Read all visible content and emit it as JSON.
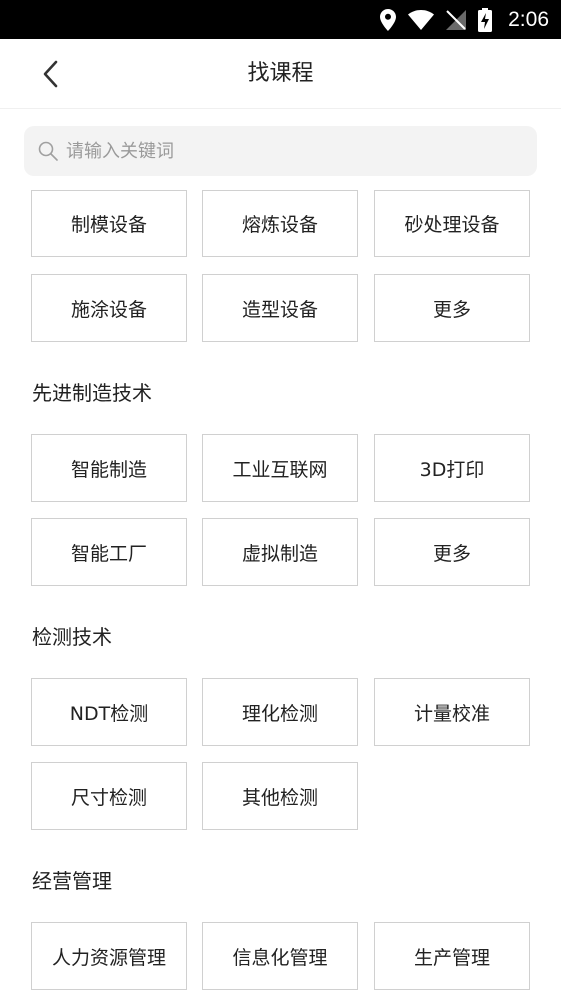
{
  "status_bar": {
    "time": "2:06"
  },
  "nav": {
    "title": "找课程"
  },
  "search": {
    "placeholder": "请输入关键词"
  },
  "equipment": {
    "items": [
      "制模设备",
      "熔炼设备",
      "砂处理设备",
      "施涂设备",
      "造型设备",
      "更多"
    ]
  },
  "advanced": {
    "title": "先进制造技术",
    "items": [
      "智能制造",
      "工业互联网",
      "3D打印",
      "智能工厂",
      "虚拟制造",
      "更多"
    ]
  },
  "inspection": {
    "title": "检测技术",
    "items": [
      "NDT检测",
      "理化检测",
      "计量校准",
      "尺寸检测",
      "其他检测"
    ]
  },
  "management": {
    "title": "经营管理",
    "items": [
      "人力资源管理",
      "信息化管理",
      "生产管理"
    ]
  }
}
